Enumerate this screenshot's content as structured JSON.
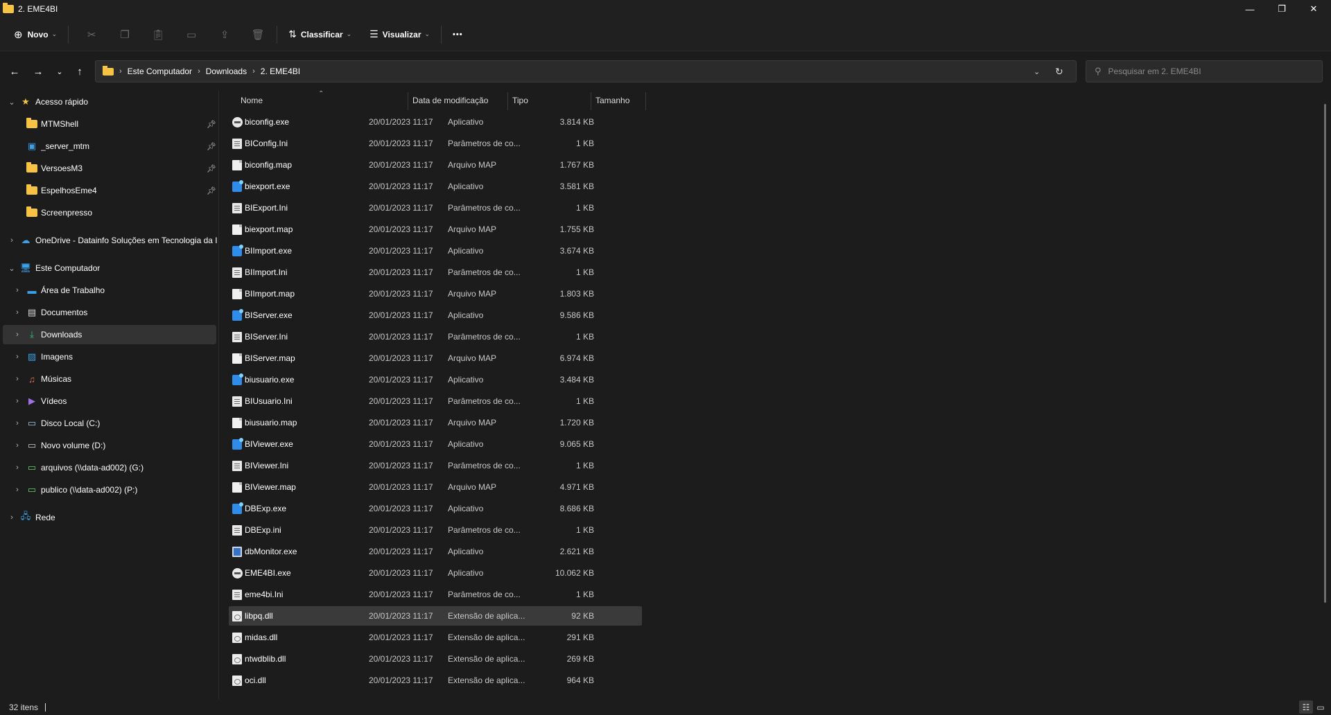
{
  "window": {
    "title": "2. EME4BI",
    "minimize": "—",
    "restore": "❐",
    "close": "✕"
  },
  "toolbar": {
    "new_label": "Novo",
    "sort_label": "Classificar",
    "view_label": "Visualizar",
    "more_label": "•••",
    "icons": [
      "cut-icon",
      "copy-icon",
      "paste-icon",
      "rename-icon",
      "share-icon",
      "delete-icon"
    ]
  },
  "address": {
    "crumbs": [
      "Este Computador",
      "Downloads",
      "2. EME4BI"
    ],
    "search_placeholder": "Pesquisar em 2. EME4BI"
  },
  "sidebar": {
    "quick_access": "Acesso rápido",
    "pinned": [
      "MTMShell",
      "_server_mtm",
      "VersoesM3",
      "EspelhosEme4"
    ],
    "recent": "Screenpresso",
    "onedrive": "OneDrive - Datainfo Soluções em Tecnologia da Ir",
    "this_pc": "Este Computador",
    "pc_items": [
      "Área de Trabalho",
      "Documentos",
      "Downloads",
      "Imagens",
      "Músicas",
      "Vídeos",
      "Disco Local (C:)",
      "Novo volume (D:)",
      "arquivos (\\\\data-ad002) (G:)",
      "publico (\\\\data-ad002) (P:)"
    ],
    "network": "Rede",
    "selected": "Downloads"
  },
  "columns": {
    "name": "Nome",
    "date": "Data de modificação",
    "type": "Tipo",
    "size": "Tamanho"
  },
  "files": [
    {
      "name": "biconfig.exe",
      "date": "20/01/2023 11:17",
      "type": "Aplicativo",
      "size": "3.814 KB",
      "icon": "round"
    },
    {
      "name": "BIConfig.Ini",
      "date": "20/01/2023 11:17",
      "type": "Parâmetros de co...",
      "size": "1 KB",
      "icon": "ini"
    },
    {
      "name": "biconfig.map",
      "date": "20/01/2023 11:17",
      "type": "Arquivo MAP",
      "size": "1.767 KB",
      "icon": "doc"
    },
    {
      "name": "biexport.exe",
      "date": "20/01/2023 11:17",
      "type": "Aplicativo",
      "size": "3.581 KB",
      "icon": "exe"
    },
    {
      "name": "BIExport.Ini",
      "date": "20/01/2023 11:17",
      "type": "Parâmetros de co...",
      "size": "1 KB",
      "icon": "ini"
    },
    {
      "name": "biexport.map",
      "date": "20/01/2023 11:17",
      "type": "Arquivo MAP",
      "size": "1.755 KB",
      "icon": "doc"
    },
    {
      "name": "BIImport.exe",
      "date": "20/01/2023 11:17",
      "type": "Aplicativo",
      "size": "3.674 KB",
      "icon": "exe"
    },
    {
      "name": "BIImport.Ini",
      "date": "20/01/2023 11:17",
      "type": "Parâmetros de co...",
      "size": "1 KB",
      "icon": "ini"
    },
    {
      "name": "BIImport.map",
      "date": "20/01/2023 11:17",
      "type": "Arquivo MAP",
      "size": "1.803 KB",
      "icon": "doc"
    },
    {
      "name": "BIServer.exe",
      "date": "20/01/2023 11:17",
      "type": "Aplicativo",
      "size": "9.586 KB",
      "icon": "exe"
    },
    {
      "name": "BIServer.Ini",
      "date": "20/01/2023 11:17",
      "type": "Parâmetros de co...",
      "size": "1 KB",
      "icon": "ini"
    },
    {
      "name": "BIServer.map",
      "date": "20/01/2023 11:17",
      "type": "Arquivo MAP",
      "size": "6.974 KB",
      "icon": "doc"
    },
    {
      "name": "biusuario.exe",
      "date": "20/01/2023 11:17",
      "type": "Aplicativo",
      "size": "3.484 KB",
      "icon": "exe"
    },
    {
      "name": "BIUsuario.Ini",
      "date": "20/01/2023 11:17",
      "type": "Parâmetros de co...",
      "size": "1 KB",
      "icon": "ini"
    },
    {
      "name": "biusuario.map",
      "date": "20/01/2023 11:17",
      "type": "Arquivo MAP",
      "size": "1.720 KB",
      "icon": "doc"
    },
    {
      "name": "BIViewer.exe",
      "date": "20/01/2023 11:17",
      "type": "Aplicativo",
      "size": "9.065 KB",
      "icon": "exe"
    },
    {
      "name": "BIViewer.Ini",
      "date": "20/01/2023 11:17",
      "type": "Parâmetros de co...",
      "size": "1 KB",
      "icon": "ini"
    },
    {
      "name": "BIViewer.map",
      "date": "20/01/2023 11:17",
      "type": "Arquivo MAP",
      "size": "4.971 KB",
      "icon": "doc"
    },
    {
      "name": "DBExp.exe",
      "date": "20/01/2023 11:17",
      "type": "Aplicativo",
      "size": "8.686 KB",
      "icon": "exe"
    },
    {
      "name": "DBExp.ini",
      "date": "20/01/2023 11:17",
      "type": "Parâmetros de co...",
      "size": "1 KB",
      "icon": "ini"
    },
    {
      "name": "dbMonitor.exe",
      "date": "20/01/2023 11:17",
      "type": "Aplicativo",
      "size": "2.621 KB",
      "icon": "monitor"
    },
    {
      "name": "EME4BI.exe",
      "date": "20/01/2023 11:17",
      "type": "Aplicativo",
      "size": "10.062 KB",
      "icon": "round"
    },
    {
      "name": "eme4bi.Ini",
      "date": "20/01/2023 11:17",
      "type": "Parâmetros de co...",
      "size": "1 KB",
      "icon": "ini"
    },
    {
      "name": "libpq.dll",
      "date": "20/01/2023 11:17",
      "type": "Extensão de aplica...",
      "size": "92 KB",
      "icon": "dll",
      "selected": true
    },
    {
      "name": "midas.dll",
      "date": "20/01/2023 11:17",
      "type": "Extensão de aplica...",
      "size": "291 KB",
      "icon": "dll"
    },
    {
      "name": "ntwdblib.dll",
      "date": "20/01/2023 11:17",
      "type": "Extensão de aplica...",
      "size": "269 KB",
      "icon": "dll"
    },
    {
      "name": "oci.dll",
      "date": "20/01/2023 11:17",
      "type": "Extensão de aplica...",
      "size": "964 KB",
      "icon": "dll"
    }
  ],
  "status": {
    "count": "32 itens"
  },
  "colors": {
    "background": "#1c1c1c",
    "chrome": "#202020",
    "folder": "#f6c342",
    "selection": "#3a3a3a"
  }
}
